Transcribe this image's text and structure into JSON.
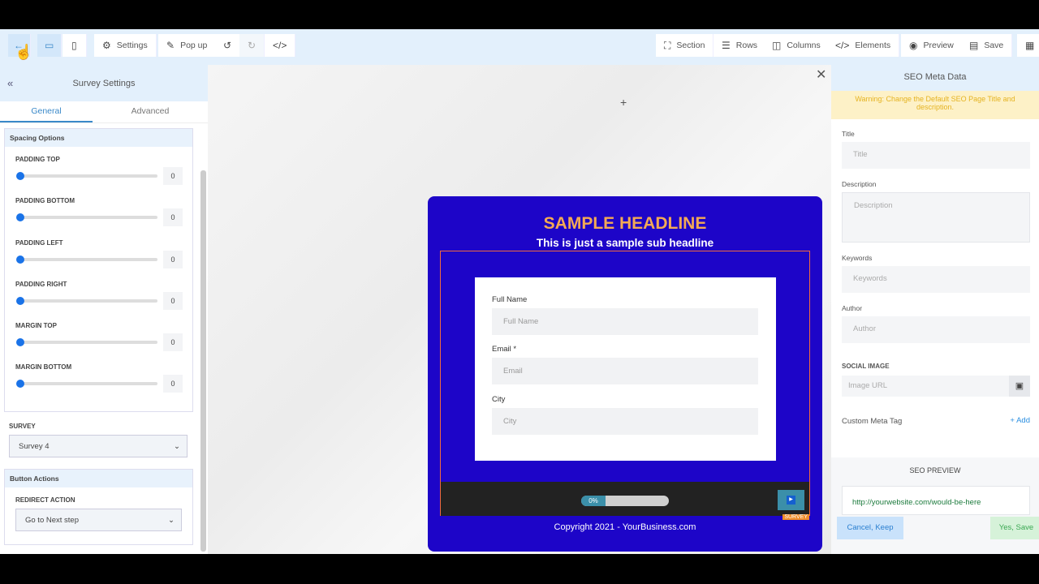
{
  "toolbar": {
    "settings": "Settings",
    "popup": "Pop up",
    "section": "Section",
    "rows": "Rows",
    "columns": "Columns",
    "elements": "Elements",
    "preview": "Preview",
    "save": "Save"
  },
  "left": {
    "title": "Survey Settings",
    "tabs": [
      "General",
      "Advanced"
    ],
    "spacing_title": "Spacing Options",
    "sliders": [
      {
        "label": "PADDING TOP",
        "value": "0"
      },
      {
        "label": "PADDING BOTTOM",
        "value": "0"
      },
      {
        "label": "PADDING LEFT",
        "value": "0"
      },
      {
        "label": "PADDING RIGHT",
        "value": "0"
      },
      {
        "label": "MARGIN TOP",
        "value": "0"
      },
      {
        "label": "MARGIN BOTTOM",
        "value": "0"
      }
    ],
    "survey_label": "SURVEY",
    "survey_value": "Survey 4",
    "actions_title": "Button Actions",
    "redirect_label": "REDIRECT ACTION",
    "redirect_value": "Go to Next step"
  },
  "popup": {
    "headline": "SAMPLE HEADLINE",
    "subheadline": "This is just a sample sub headline",
    "fields": [
      {
        "label": "Full Name",
        "placeholder": "Full Name"
      },
      {
        "label": "Email *",
        "placeholder": "Email"
      },
      {
        "label": "City",
        "placeholder": "City"
      }
    ],
    "progress": "0%",
    "progress_value": 0,
    "survey_tag": "SURVEY",
    "copyright": "Copyright 2021 - YourBusiness.com"
  },
  "seo": {
    "title": "SEO Meta Data",
    "warning": "Warning: Change the Default SEO Page Title and description.",
    "title_label": "Title",
    "title_ph": "Title",
    "desc_label": "Description",
    "desc_ph": "Description",
    "kw_label": "Keywords",
    "kw_ph": "Keywords",
    "author_label": "Author",
    "author_ph": "Author",
    "social_label": "SOCIAL IMAGE",
    "image_ph": "Image URL",
    "custom_meta": "Custom Meta Tag",
    "add": "Add",
    "preview_title": "SEO PREVIEW",
    "preview_url": "http://yourwebsite.com/would-be-here",
    "cancel": "Cancel, Keep",
    "yes": "Yes, Save"
  }
}
